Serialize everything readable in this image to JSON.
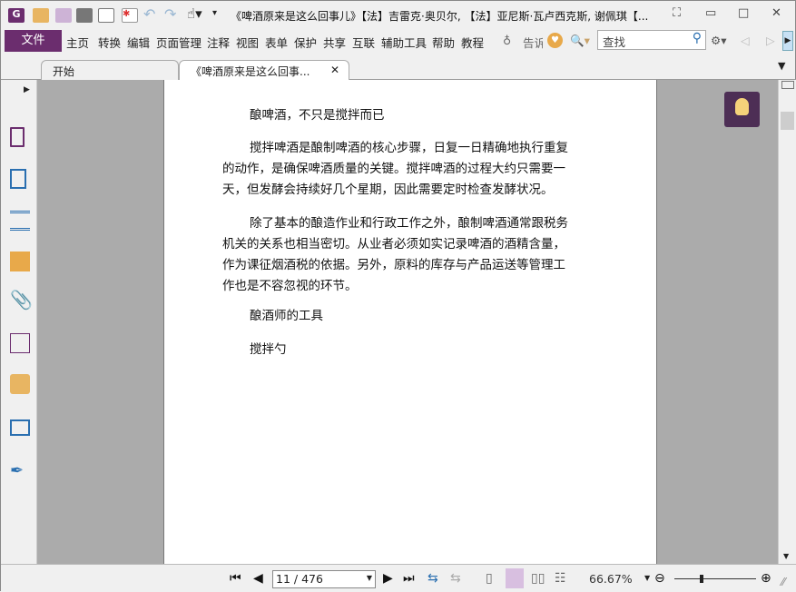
{
  "window": {
    "title": "《啤酒原来是这么回事儿》【法】吉雷克·奥贝尔, 【法】亚尼斯·瓦卢西克斯, 谢佩琪【...",
    "fullscreen_icon": "⛶",
    "minimize": "▭",
    "maximize": "□",
    "close": "✕"
  },
  "menu": {
    "file": "文件",
    "items": [
      "主页",
      "转换",
      "编辑",
      "页面管理",
      "注释",
      "视图",
      "表单",
      "保护",
      "共享",
      "互联",
      "辅助工具",
      "帮助",
      "教程"
    ],
    "tell": "告诉",
    "search_placeholder": "查找"
  },
  "tabs": [
    {
      "label": "开始"
    },
    {
      "label": "《啤酒原来是这么回事...",
      "close": "✕"
    }
  ],
  "document": {
    "heading1": "酿啤酒，不只是搅拌而已",
    "para1": [
      "搅拌啤酒是酿制啤酒的核心步骤，日复一日精确地执行重复",
      "的动作，是确保啤酒质量的关键。搅拌啤酒的过程大约只需要一",
      "天，但发酵会持续好几个星期，因此需要定时检查发酵状况。"
    ],
    "para2": [
      "除了基本的酿造作业和行政工作之外，酿制啤酒通常跟税务",
      "机关的关系也相当密切。从业者必须如实记录啤酒的酒精含量，",
      "作为课征烟酒税的依据。另外，原料的库存与产品运送等管理工",
      "作也是不容忽视的环节。"
    ],
    "heading2": "酿酒师的工具",
    "heading3": "搅拌勺"
  },
  "status": {
    "page": "11 / 476",
    "zoom": "66.67%",
    "zoom_fraction": 0.33
  },
  "colors": {
    "accent": "#6b2d6e",
    "bulb_bg": "#4d2e55"
  }
}
